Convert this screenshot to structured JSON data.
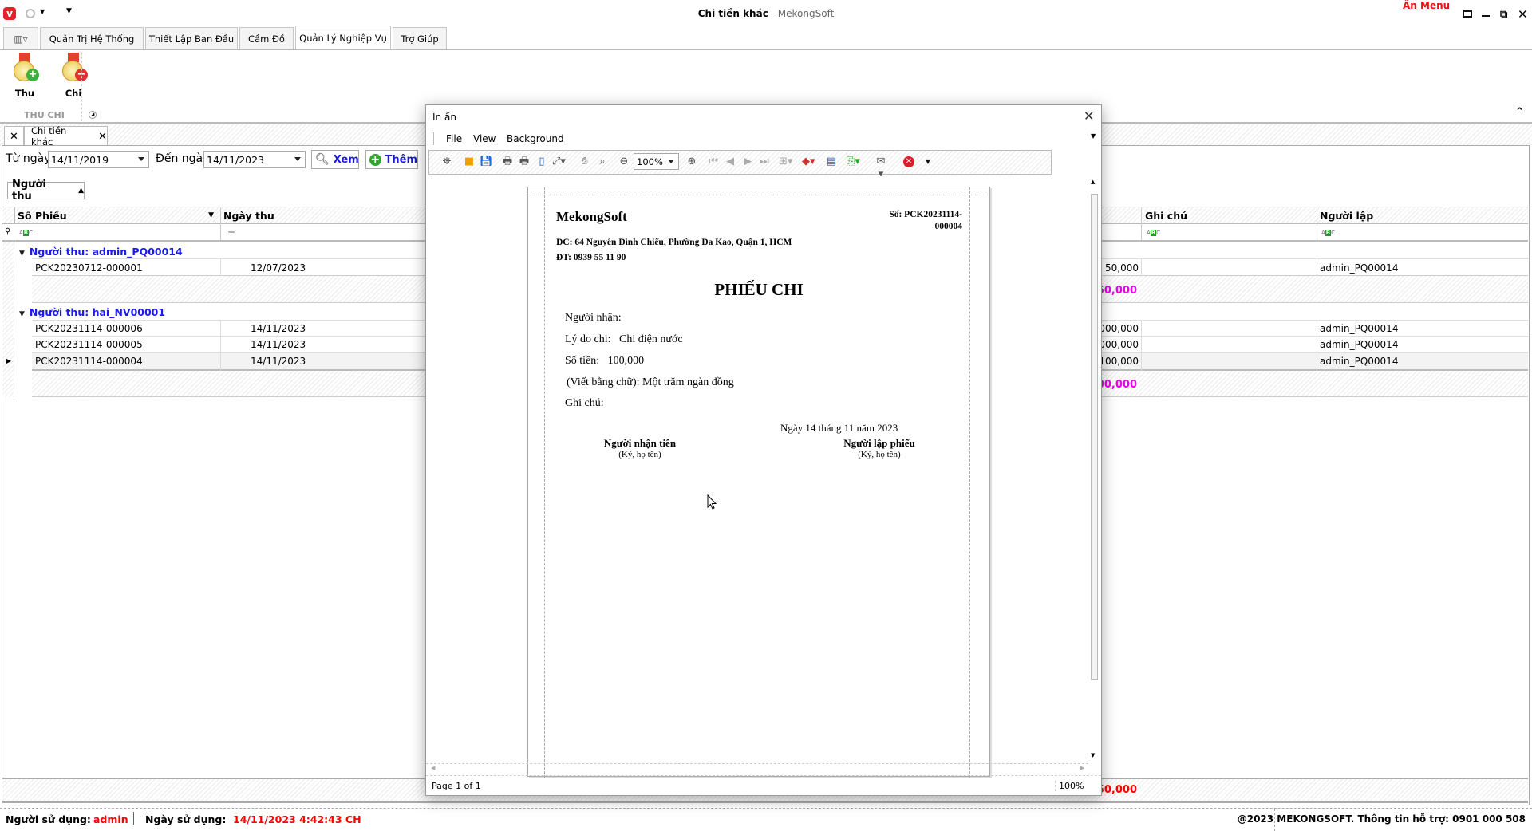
{
  "window": {
    "title": "Chi tiền khác",
    "app_name": "MekongSoft",
    "hide_menu": "Ẩn Menu"
  },
  "ribbon": {
    "tabs": [
      {
        "label": "Quản Trị Hệ Thống"
      },
      {
        "label": "Thiết Lập Ban Đầu"
      },
      {
        "label": "Cầm Đồ"
      },
      {
        "label": "Quản Lý Nghiệp Vụ"
      },
      {
        "label": "Trợ Giúp"
      }
    ],
    "active_tab": "Quản Lý Nghiệp Vụ",
    "buttons": [
      {
        "label": "Thu"
      },
      {
        "label": "Chi"
      }
    ],
    "group_label": "THU CHI"
  },
  "doc_tab": {
    "label": "Chi tiền khác"
  },
  "filter": {
    "from_label": "Từ ngày",
    "from_value": "14/11/2019",
    "to_label": "Đến ngày",
    "to_value": "14/11/2023",
    "view_label": "Xem",
    "add_label": "Thêm"
  },
  "grid": {
    "group_by": "Người thu",
    "columns": {
      "so_phieu": "Số Phiếu",
      "ngay_thu": "Ngày thu",
      "ghi_chu": "Ghi chú",
      "nguoi_lap": "Người lập"
    },
    "groups": [
      {
        "label": "Người thu: admin_PQ00014",
        "rows": [
          {
            "so_phieu": "PCK20230712-000001",
            "ngay_thu": "12/07/2023",
            "amount": "50,000",
            "nguoi_lap": "admin_PQ00014"
          }
        ],
        "total": "50,000"
      },
      {
        "label": "Người thu: hai_NV00001",
        "rows": [
          {
            "so_phieu": "PCK20231114-000006",
            "ngay_thu": "14/11/2023",
            "amount": "000,000",
            "nguoi_lap": "admin_PQ00014"
          },
          {
            "so_phieu": "PCK20231114-000005",
            "ngay_thu": "14/11/2023",
            "amount": "000,000",
            "nguoi_lap": "admin_PQ00014"
          },
          {
            "so_phieu": "PCK20231114-000004",
            "ngay_thu": "14/11/2023",
            "amount": "100,000",
            "nguoi_lap": "admin_PQ00014"
          }
        ],
        "total": "00,000"
      }
    ],
    "grand_total": "50,000"
  },
  "dialog": {
    "title": "In ấn",
    "menu": [
      "File",
      "View",
      "Background"
    ],
    "zoom": "100%",
    "page_info": "Page 1 of 1",
    "zoom_status": "100%"
  },
  "document": {
    "company": "MekongSoft",
    "number": "Số: PCK20231114-000004",
    "address": "ĐC: 64 Nguyễn Đình Chiểu, Phường Đa Kao, Quận 1, HCM",
    "phone": "ĐT: 0939 55 11 90",
    "heading": "PHIẾU CHI",
    "recipient_label": "Người nhận:",
    "reason_label": "Lý do chi:",
    "reason": "Chi điện nước",
    "amount_label": "Số tiền:",
    "amount": "100,000",
    "words_label": "(Viết bằng chữ):",
    "words": "Một trăm ngàn đồng",
    "note_label": "Ghi chú:",
    "date_line": "Ngày 14 tháng 11 năm 2023",
    "sign_left": "Người nhận tiên",
    "sign_left_sub": "(Ký, họ tên)",
    "sign_right": "Người lập phiếu",
    "sign_right_sub": "(Ký, họ tên)"
  },
  "statusbar": {
    "user_label": "Người sử dụng:",
    "user": "admin",
    "date_label": "Ngày sử dụng:",
    "date": "14/11/2023 4:42:43 CH",
    "copyright": "@2023 MEKONGSOFT. Thông tin hỗ trợ: 0901 000 508"
  },
  "colors": {
    "accent": "#1a1af0",
    "total": "#e800e8",
    "alert": "#ff0000"
  }
}
